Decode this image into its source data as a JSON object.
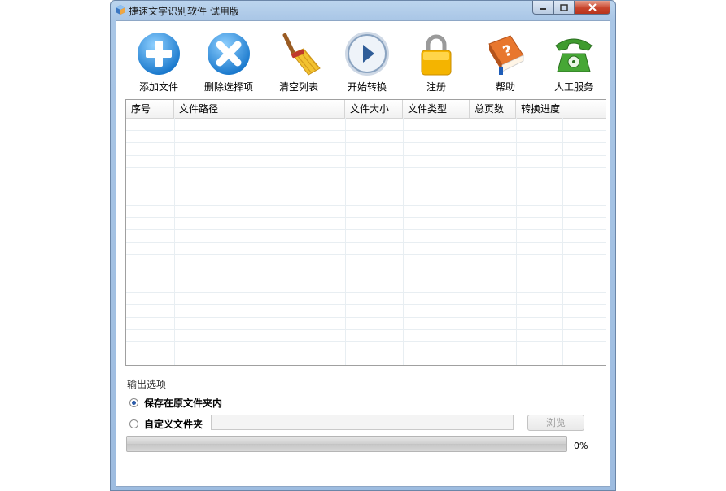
{
  "window": {
    "title": "捷速文字识别软件 试用版"
  },
  "toolbar": {
    "buttons": [
      {
        "label": "添加文件",
        "icon": "add-icon"
      },
      {
        "label": "删除选择项",
        "icon": "delete-icon"
      },
      {
        "label": "清空列表",
        "icon": "broom-icon"
      },
      {
        "label": "开始转换",
        "icon": "play-icon"
      },
      {
        "label": "注册",
        "icon": "lock-icon"
      },
      {
        "label": "帮助",
        "icon": "help-book-icon"
      },
      {
        "label": "人工服务",
        "icon": "phone-icon"
      }
    ]
  },
  "table": {
    "columns": [
      "序号",
      "文件路径",
      "文件大小",
      "文件类型",
      "总页数",
      "转换进度"
    ],
    "rows": []
  },
  "output": {
    "section_title": "输出选项",
    "option_original": "保存在原文件夹内",
    "option_custom": "自定义文件夹",
    "selected": "option_original",
    "custom_folder_value": "",
    "browse_label": "浏览"
  },
  "progress": {
    "value": 0,
    "label": "0%"
  },
  "colors": {
    "titlebar": "#a9c6e6",
    "add_icon": "#2e93dd",
    "delete_icon": "#2e93dd",
    "lock_icon": "#f4b400",
    "help_book": "#e8772e",
    "phone_icon": "#3f9b2f",
    "progress_fill": "#3db33d"
  }
}
